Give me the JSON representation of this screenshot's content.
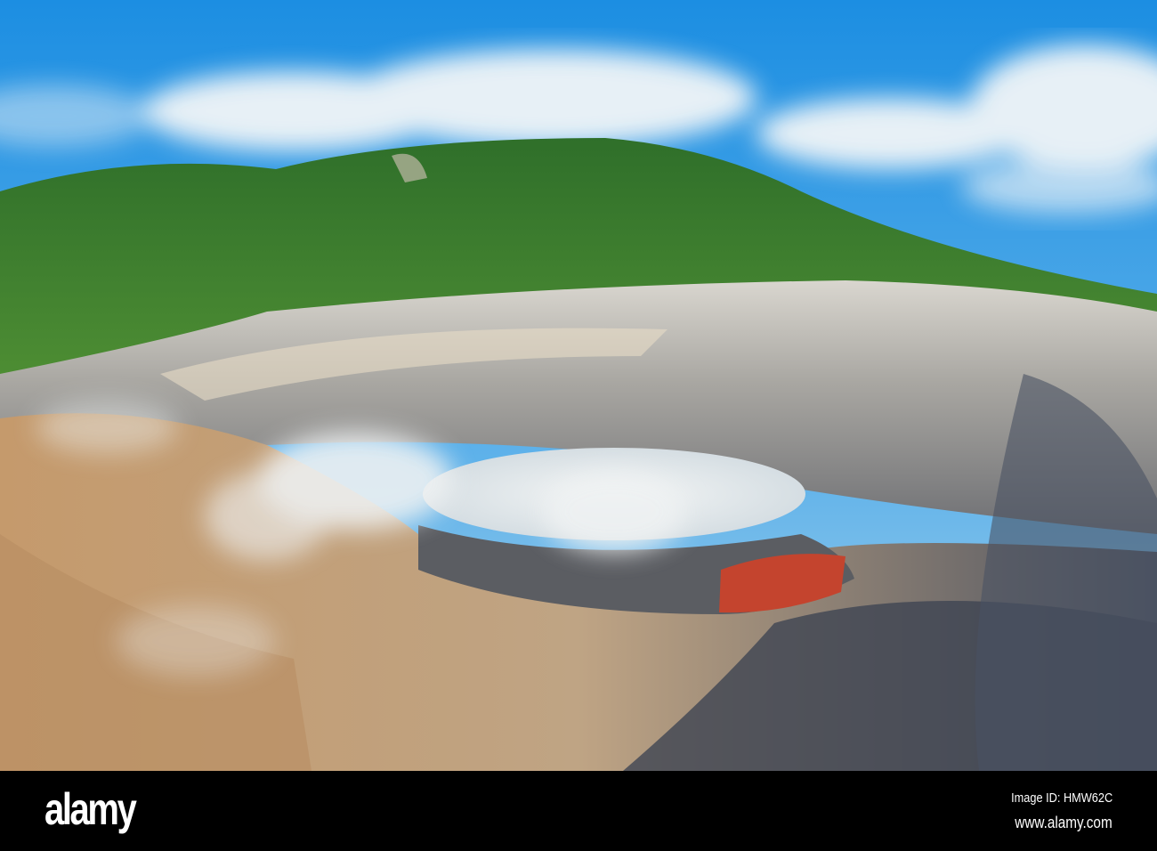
{
  "watermark": {
    "logo": "alamy",
    "image_id": "Image ID: HMW62C",
    "website": "www.alamy.com"
  },
  "colors": {
    "sky_top": "#1e8fe0",
    "sky_horizon": "#a9d3ee",
    "forest": "#3f7f2c",
    "crater_wall": "#b8b3aa",
    "lake": "#dfe6ea",
    "crater_floor": "#c2a47c",
    "red_streak": "#c4442e"
  }
}
